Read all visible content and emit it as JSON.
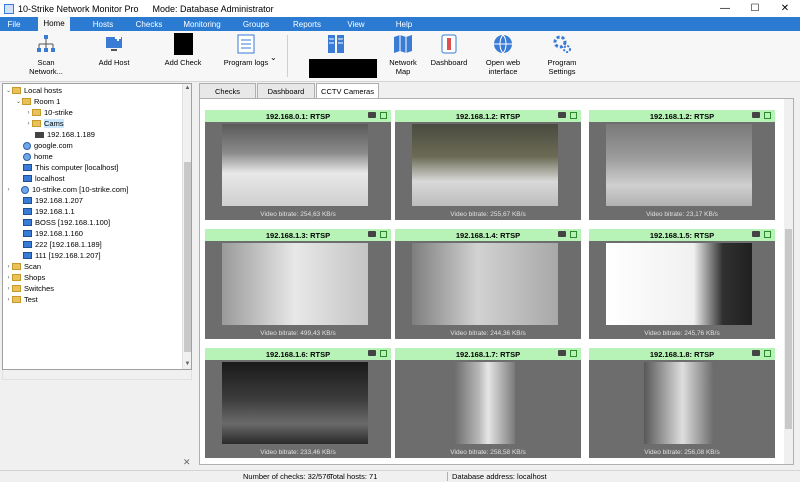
{
  "window": {
    "title": "10-Strike Network Monitor Pro",
    "mode": "Mode: Database Administrator"
  },
  "menu": {
    "items": [
      "File",
      "Home",
      "Hosts",
      "Checks",
      "Monitoring",
      "Groups",
      "Reports",
      "View",
      "Help"
    ],
    "active": "Home"
  },
  "ribbon": {
    "scan_network": "Scan Network...",
    "add_host": "Add Host",
    "add_check": "Add Check",
    "program_logs": "Program logs",
    "network_map_1": "Network",
    "network_map_2": "Map",
    "dashboard": "Dashboard",
    "open_web_1": "Open web",
    "open_web_2": "interface",
    "program_settings_1": "Program",
    "program_settings_2": "Settings"
  },
  "tree": {
    "local_hosts": "Local hosts",
    "room1": "Room 1",
    "strike": "10-strike",
    "cams": "Cams",
    "ip189": "192.168.1.189",
    "google": "google.com",
    "home": "home",
    "this_computer": "This computer [localhost]",
    "localhost": "localhost",
    "strike_com": "10-strike.com [10-strike.com]",
    "ip207": "192.168.1.207",
    "ip1": "192.168.1.1",
    "boss": "BOSS [192.168.1.100]",
    "ip160": "192.168.1.160",
    "h222": "222 [192.168.1.189]",
    "h111": "111 [192.168.1.207]",
    "scan": "Scan",
    "shops": "Shops",
    "switches": "Switches",
    "test": "Test"
  },
  "tabs": [
    "Checks",
    "Dashboard",
    "CCTV Cameras"
  ],
  "active_tab": "CCTV Cameras",
  "cameras": [
    {
      "title": "192.168.0.1: RTSP",
      "bitrate": "Video bitrate: 254,63 KB/s"
    },
    {
      "title": "192.168.1.2: RTSP",
      "bitrate": "Video bitrate: 255,67 KB/s"
    },
    {
      "title": "192.168.1.2: RTSP",
      "bitrate": "Video bitrate: 23,17 KB/s"
    },
    {
      "title": "192.168.1.3: RTSP",
      "bitrate": "Video bitrate: 499,43 KB/s"
    },
    {
      "title": "192.168.1.4: RTSP",
      "bitrate": "Video bitrate: 244,36 KB/s"
    },
    {
      "title": "192.168.1.5: RTSP",
      "bitrate": "Video bitrate: 245,76 KB/s"
    },
    {
      "title": "192.168.1.6: RTSP",
      "bitrate": "Video bitrate: 233,46 KB/s"
    },
    {
      "title": "192.168.1.7: RTSP",
      "bitrate": "Video bitrate: 258,58 KB/s"
    },
    {
      "title": "192.168.1.8: RTSP",
      "bitrate": "Video bitrate: 256,08 KB/s"
    }
  ],
  "status": {
    "checks": "Number of checks: 32/576",
    "hosts": "Total hosts: 71",
    "db": "Database address: localhost"
  },
  "colors": {
    "menu_bg": "#2b7bd3",
    "camera_header": "#b7f3b7"
  }
}
